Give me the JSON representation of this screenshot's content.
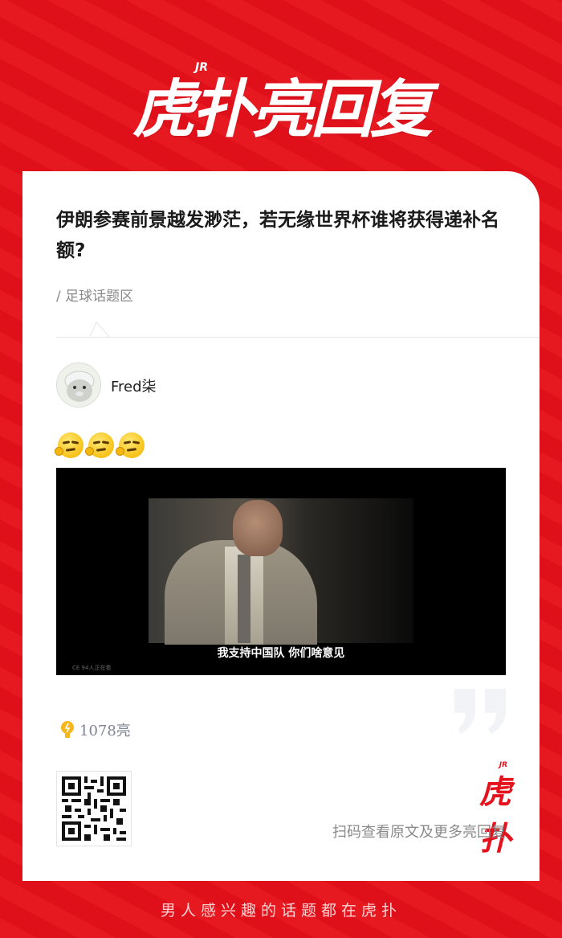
{
  "header": {
    "logo_text": "虎扑亮回复",
    "logo_superscript": "JR"
  },
  "post": {
    "title": "伊朗参赛前景越发渺茫，若无缘世界杯谁将获得递补名额?",
    "category": "/ 足球话题区"
  },
  "reply": {
    "username": "Fred柒",
    "emoji_count": 3,
    "video_subtitle": "我支持中国队  你们啥意见",
    "video_watermark": "CE 94人正在看",
    "likes": "1078亮"
  },
  "share": {
    "scan_text": "扫码查看原文及更多亮回复",
    "small_logo_text": "虎扑",
    "small_logo_superscript": "JR"
  },
  "footer": {
    "slogan": "男人感兴趣的话题都在虎扑"
  },
  "colors": {
    "brand_red": "#e5121d",
    "text_dark": "#1a1a1a",
    "text_gray": "#8a8a8a",
    "like_gold": "#f5b71b"
  }
}
